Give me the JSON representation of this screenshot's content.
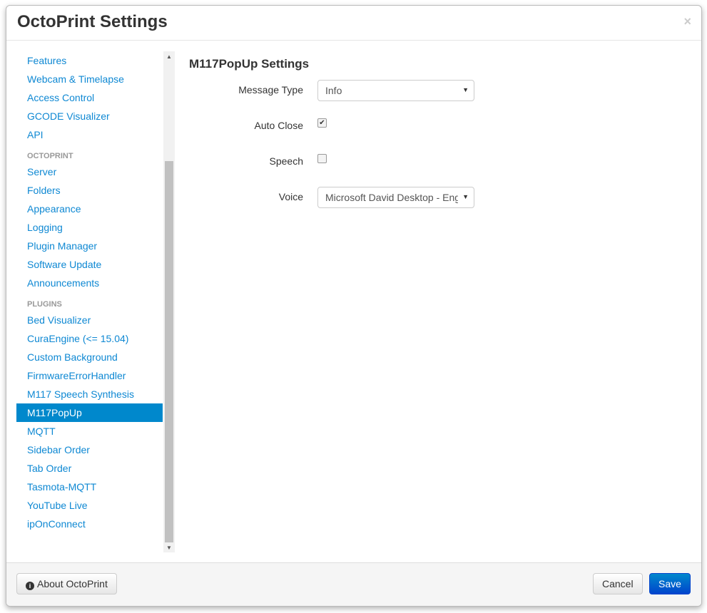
{
  "header": {
    "title": "OctoPrint Settings",
    "close": "×"
  },
  "sidebar": {
    "sections": [
      {
        "title": "Features",
        "items": [
          "Features",
          "Webcam & Timelapse",
          "Access Control",
          "GCODE Visualizer",
          "API"
        ]
      },
      {
        "title": "OctoPrint",
        "items": [
          "Server",
          "Folders",
          "Appearance",
          "Logging",
          "Plugin Manager",
          "Software Update",
          "Announcements"
        ]
      },
      {
        "title": "Plugins",
        "items": [
          "Bed Visualizer",
          "CuraEngine (<= 15.04)",
          "Custom Background",
          "FirmwareErrorHandler",
          "M117 Speech Synthesis",
          "M117PopUp",
          "MQTT",
          "Sidebar Order",
          "Tab Order",
          "Tasmota-MQTT",
          "YouTube Live",
          "ipOnConnect"
        ]
      }
    ],
    "active": "M117PopUp",
    "accent": "#0088cc"
  },
  "main": {
    "title": "M117PopUp Settings",
    "message_type": {
      "label": "Message Type",
      "value": "Info"
    },
    "auto_close": {
      "label": "Auto Close",
      "checked": true
    },
    "speech": {
      "label": "Speech",
      "checked": false
    },
    "voice": {
      "label": "Voice",
      "value": "Microsoft David Desktop - English"
    }
  },
  "footer": {
    "about": "About OctoPrint",
    "cancel": "Cancel",
    "save": "Save"
  }
}
